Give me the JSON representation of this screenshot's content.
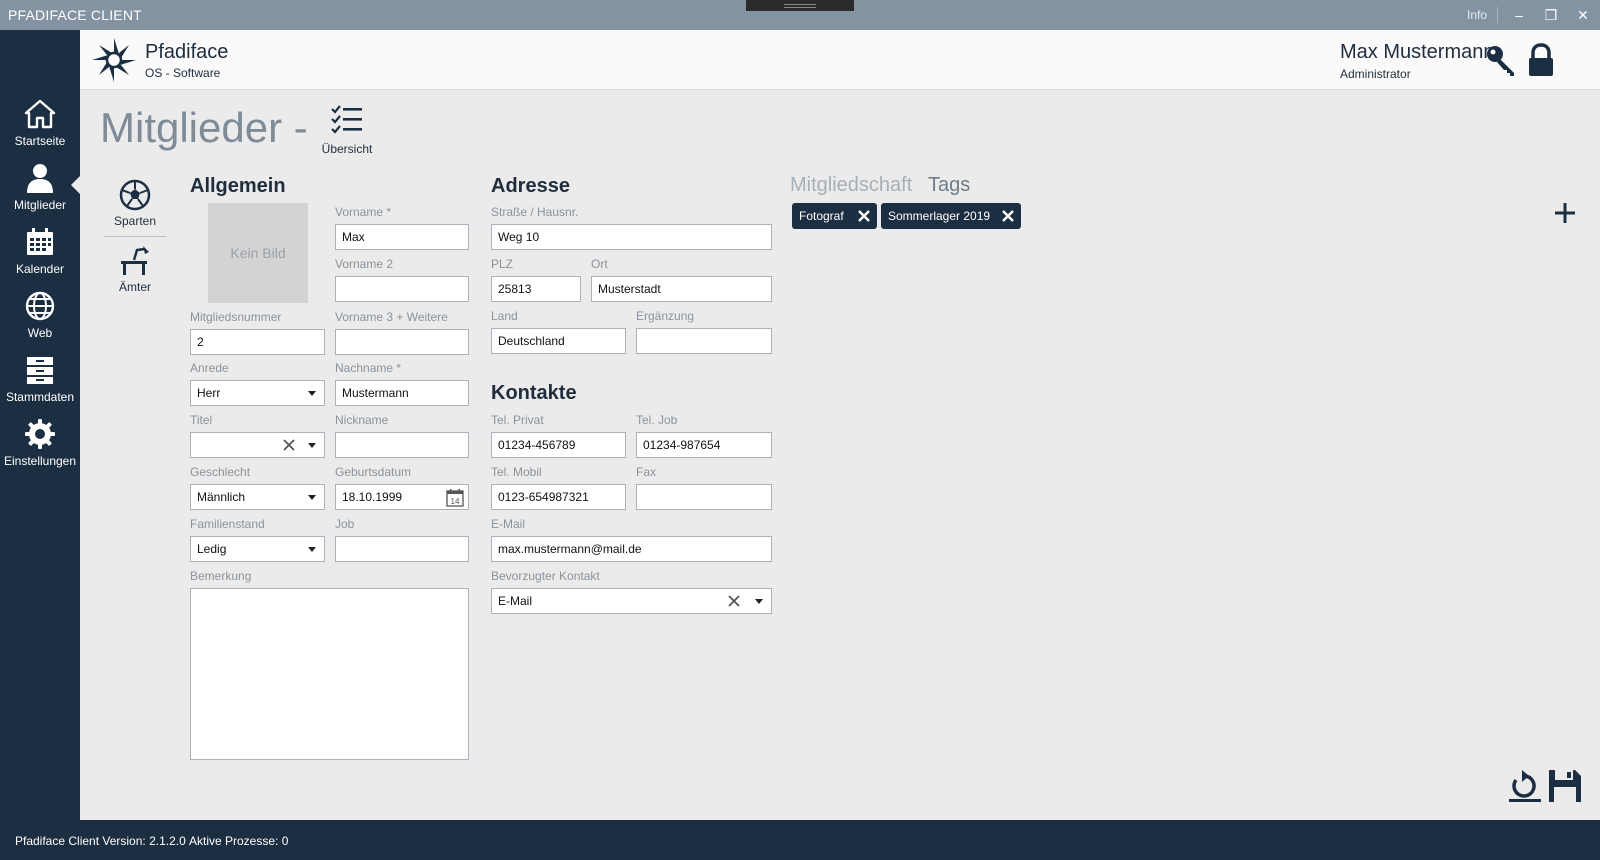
{
  "window": {
    "title": "PFADIFACE CLIENT",
    "info_label": "Info",
    "minimize_glyph": "–",
    "restore_glyph": "❒",
    "close_glyph": "✕"
  },
  "sidebar": {
    "items": [
      {
        "label": "Startseite",
        "icon": "home-icon"
      },
      {
        "label": "Mitglieder",
        "icon": "user-icon"
      },
      {
        "label": "Kalender",
        "icon": "calendar-icon"
      },
      {
        "label": "Web",
        "icon": "globe-icon"
      },
      {
        "label": "Stammdaten",
        "icon": "archive-icon"
      },
      {
        "label": "Einstellungen",
        "icon": "gear-icon"
      }
    ],
    "active": "Mitglieder"
  },
  "header": {
    "brand": "Pfadiface",
    "brand_sub": "OS - Software",
    "user_name": "Max Mustermann",
    "user_role": "Administrator"
  },
  "page": {
    "title": "Mitglieder -",
    "overview_label": "Übersicht"
  },
  "subnav": {
    "items": [
      {
        "label": "Sparten",
        "icon": "soccer-ball-icon"
      },
      {
        "label": "Ämter",
        "icon": "desk-lamp-icon"
      }
    ]
  },
  "general": {
    "title": "Allgemein",
    "photo_placeholder": "Kein Bild",
    "vorname1_label": "Vorname *",
    "vorname1_value": "Max",
    "vorname2_label": "Vorname 2",
    "vorname2_value": "",
    "vorname3_label": "Vorname 3 + Weitere",
    "vorname3_value": "",
    "mitgliedsnummer_label": "Mitgliedsnummer",
    "mitgliedsnummer_value": "2",
    "anrede_label": "Anrede",
    "anrede_value": "Herr",
    "nachname_label": "Nachname *",
    "nachname_value": "Mustermann",
    "titel_label": "Titel",
    "titel_value": "",
    "nickname_label": "Nickname",
    "nickname_value": "",
    "geschlecht_label": "Geschlecht",
    "geschlecht_value": "Männlich",
    "geburtsdatum_label": "Geburtsdatum",
    "geburtsdatum_value": "18.10.1999",
    "calendar_day": "14",
    "familienstand_label": "Familienstand",
    "familienstand_value": "Ledig",
    "job_label": "Job",
    "job_value": "",
    "bemerkung_label": "Bemerkung",
    "bemerkung_value": ""
  },
  "address": {
    "title": "Adresse",
    "strasse_label": "Straße / Hausnr.",
    "strasse_value": "Weg 10",
    "plz_label": "PLZ",
    "plz_value": "25813",
    "ort_label": "Ort",
    "ort_value": "Musterstadt",
    "land_label": "Land",
    "land_value": "Deutschland",
    "ergaenzung_label": "Ergänzung",
    "ergaenzung_value": ""
  },
  "contacts": {
    "title": "Kontakte",
    "privat_label": "Tel. Privat",
    "privat_value": "01234-456789",
    "job_label": "Tel. Job",
    "job_value": "01234-987654",
    "mobil_label": "Tel. Mobil",
    "mobil_value": "0123-654987321",
    "fax_label": "Fax",
    "fax_value": "",
    "email_label": "E-Mail",
    "email_value": "max.mustermann@mail.de",
    "bevorzugt_label": "Bevorzugter Kontakt",
    "bevorzugt_value": "E-Mail"
  },
  "membership": {
    "tabs": [
      {
        "label": "Mitgliedschaft",
        "active": false
      },
      {
        "label": "Tags",
        "active": true
      }
    ],
    "tags": [
      "Fotograf",
      "Sommerlager 2019"
    ]
  },
  "status": {
    "version": "Pfadiface Client Version: 2.1.2.0",
    "processes": "Aktive Prozesse: 0"
  },
  "colors": {
    "sidebar": "#1c2e42",
    "titlebar": "#8493a1",
    "background": "#ebebeb",
    "page_title": "#7f8c98"
  }
}
